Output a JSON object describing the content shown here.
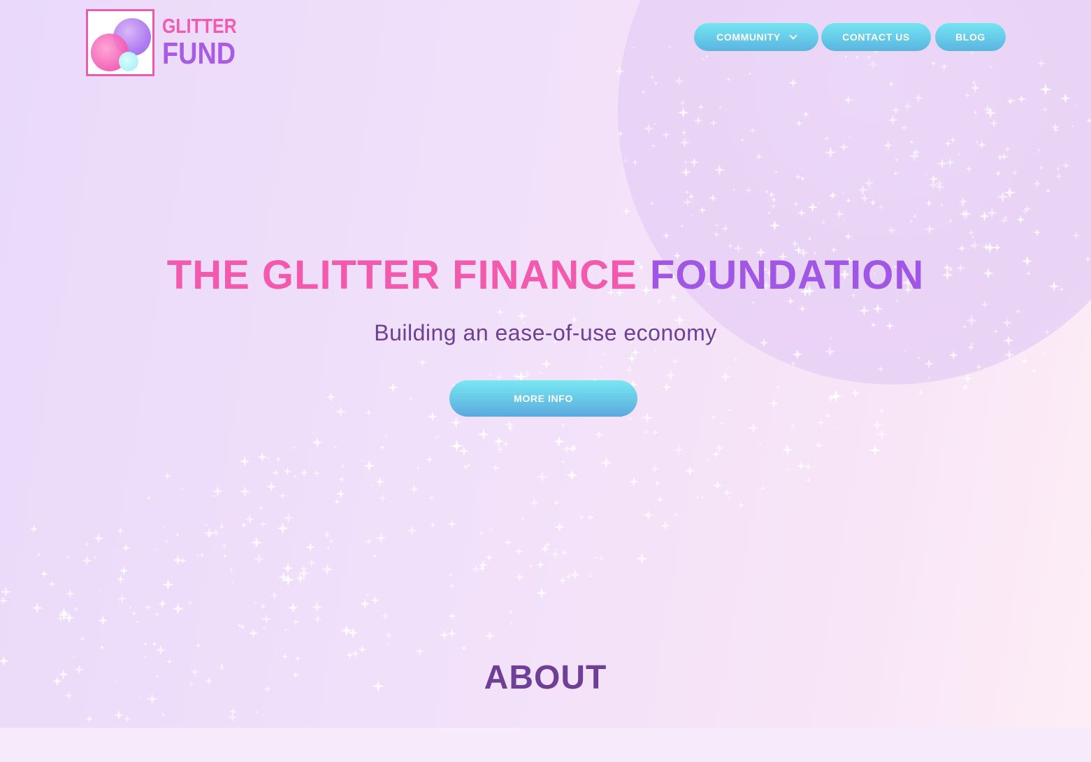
{
  "brand": {
    "logo_line1": "GLITTER",
    "logo_line2": "FUND",
    "pink": "#f35aae",
    "purple": "#a057e6",
    "cyan": "#74e5f1"
  },
  "nav": {
    "community_label": "COMMUNITY",
    "contact_label": "CONTACT US",
    "blog_label": "BLOG"
  },
  "hero": {
    "headline_part1": "THE GLITTER FINANCE",
    "headline_part2": "FOUNDATION",
    "tagline": "Building an ease-of-use economy",
    "cta_label": "MORE INFO"
  },
  "about": {
    "title": "ABOUT"
  }
}
